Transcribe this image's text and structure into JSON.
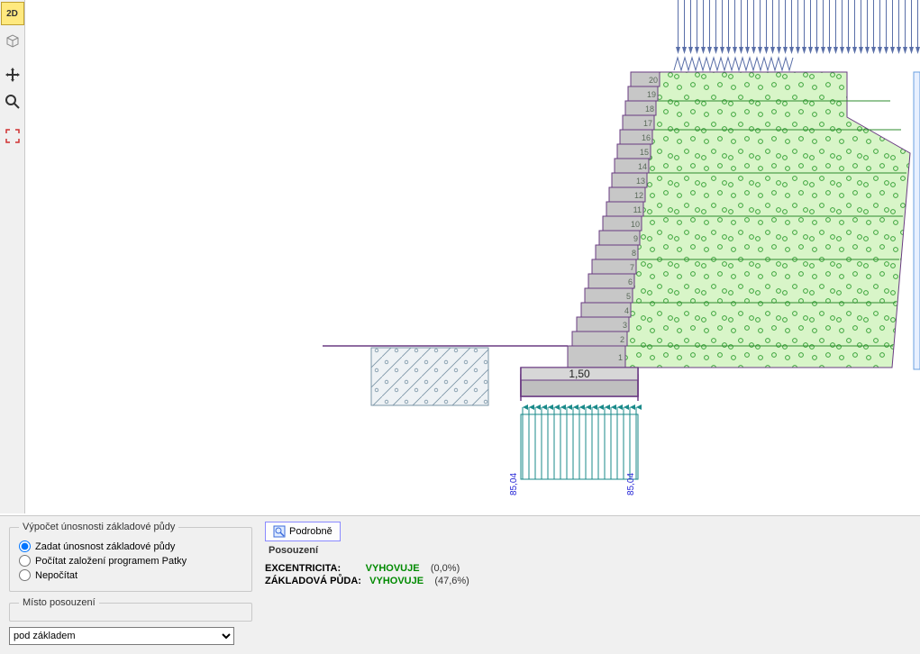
{
  "toolbar": {
    "mode2d": "2D"
  },
  "panel": {
    "calc_group_title": "Výpočet únosnosti základové půdy",
    "radio1": "Zadat únosnost základové půdy",
    "radio2": "Počítat založení programem Patky",
    "radio3": "Nepočítat",
    "place_group_title": "Místo posouzení",
    "place_option": "pod základem"
  },
  "detail_btn": "Podrobně",
  "assessment": {
    "title": "Posouzení",
    "rows": [
      {
        "label": "EXCENTRICITA:",
        "status": "VYHOVUJE",
        "pct": "(0,0%)"
      },
      {
        "label": "ZÁKLADOVÁ PŮDA:",
        "status": "VYHOVUJE",
        "pct": "(47,6%)"
      }
    ]
  },
  "drawing": {
    "foundation_dim": "1,50",
    "reaction_left": "85,04",
    "reaction_right": "85,04",
    "block_labels": [
      "1",
      "2",
      "3",
      "4",
      "5",
      "6",
      "7",
      "8",
      "9",
      "10",
      "11",
      "12",
      "13",
      "14",
      "15",
      "16",
      "17",
      "18",
      "19",
      "20"
    ]
  }
}
